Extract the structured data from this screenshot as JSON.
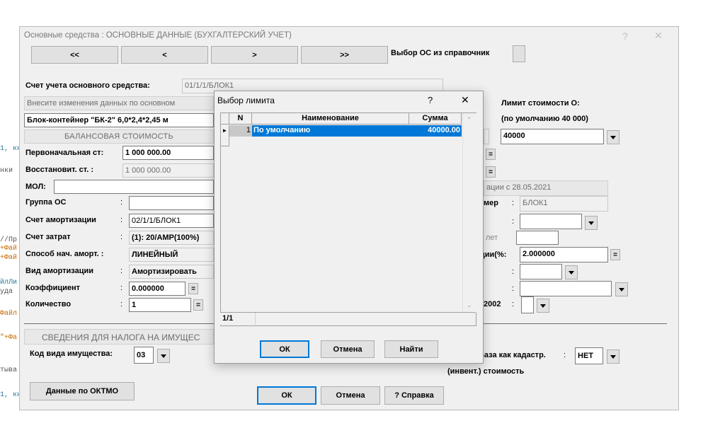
{
  "bg_code": {
    "line1": "1, кн",
    "line2": "нки",
    "line3": "//Пр",
    "line4": "+Фай",
    "line5": "+Фай",
    "line6": "йлЛи",
    "line7": "уда",
    "line8": "Файл",
    "line9": "\"+Фа",
    "line10": "тыва",
    "line11": "1, кн"
  },
  "main": {
    "title": "Основные средства : ОСНОВНЫЕ ДАННЫЕ (БУХГАЛТЕРСКИЙ УЧЕТ)",
    "help_glyph": "?",
    "close_glyph": "✕",
    "nav": {
      "first": "<<",
      "prev": "<",
      "next": ">",
      "last": ">>"
    },
    "select_from_ref_label": "Выбор ОС из справочник",
    "account_label": "Счет учета основного средства:",
    "account_value": "01/1/1/БЛОК1",
    "changes_panel": "Внесите изменения данных по основном",
    "name_value": "Блок-контейнер \"БК-2\" 6,0*2,4*2,45 м",
    "balance_header": "БАЛАНСОВАЯ СТОИМОСТЬ",
    "initial_cost_label": "Первоначальная ст:",
    "initial_cost_value": "1 000 000.00",
    "restore_cost_label": "Восстановит. ст. :",
    "restore_cost_value": "1 000 000.00",
    "mol_label": "МОЛ:",
    "group_label": "Группа ОС",
    "amort_account_label": "Счет амортизации",
    "amort_account_value": "02/1/1/БЛОК1",
    "cost_account_label": "Счет затрат",
    "cost_account_value": "(1): 20/АМР(100%)",
    "method_label": "Способ нач. аморт. :",
    "method_value": "ЛИНЕЙНЫЙ",
    "amort_type_label": "Вид амортизации",
    "amort_type_value": "Амортизировать",
    "coef_label": "Коэффициент",
    "coef_value": "0.000000",
    "qty_label": "Количество",
    "qty_value": "1",
    "colon": ":",
    "eq": "=",
    "limit_label": "Лимит стоимости О:",
    "limit_default_label": "(по умолчанию 40 000)",
    "limit_value": "40000",
    "amort_date_panel": "ации с 28.05.2021",
    "number_label": "мер",
    "number_value": "БЛОК1",
    "years_label": "лет",
    "rate_label": "ции(%:",
    "rate_value": "2.000000",
    "year2002_label": "2002",
    "tax_panel": "СВЕДЕНИЯ ДЛЯ НАЛОГА НА ИМУЩЕС",
    "property_code_label": "Код вида имущества:",
    "property_code_value": "03",
    "cadastral_label": "База как кадастр.",
    "cadastral_value": "НЕТ",
    "inventory_label": "(инвент.) стоимость",
    "oktmo_button": "Данные по ОКТМО",
    "ok_button": "ОК",
    "cancel_button": "Отмена",
    "help_button": "? Справка"
  },
  "popup": {
    "title": "Выбор лимита",
    "help_glyph": "?",
    "close_glyph": "✕",
    "columns": {
      "n": "N",
      "name": "Наименование",
      "sum": "Сумма"
    },
    "rows": [
      {
        "n": "1",
        "name": "По умолчанию",
        "sum": "40000.00"
      }
    ],
    "status": "1/1",
    "ok_button": "ОК",
    "cancel_button": "Отмена",
    "find_button": "Найти"
  }
}
